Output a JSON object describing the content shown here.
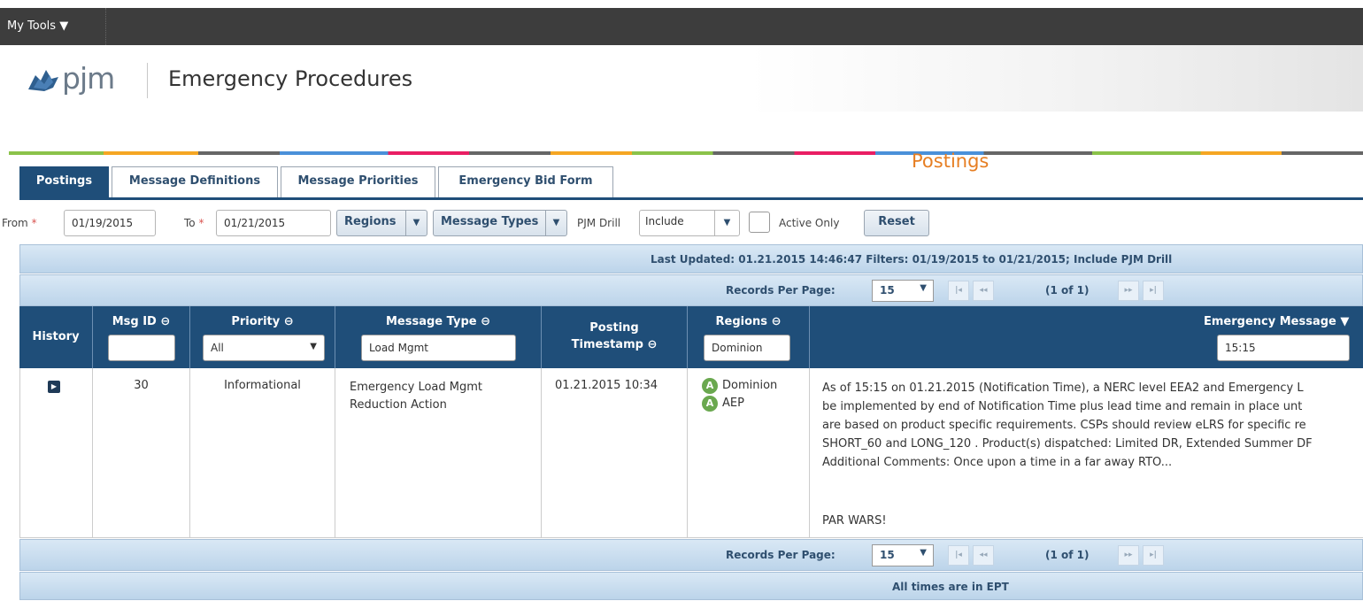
{
  "topbar": {
    "menu_label": "My Tools ▼"
  },
  "brand": {
    "logo_text": "pjm",
    "app_title": "Emergency Procedures"
  },
  "page_heading": "Postings",
  "tabs": [
    {
      "label": "Postings",
      "active": true
    },
    {
      "label": "Message Definitions",
      "active": false
    },
    {
      "label": "Message Priorities",
      "active": false
    },
    {
      "label": "Emergency Bid Form",
      "active": false
    }
  ],
  "filters": {
    "from_label": "From",
    "from_value": "01/19/2015",
    "to_label": "To",
    "to_value": "01/21/2015",
    "required_mark": "*",
    "regions_label": "Regions",
    "message_types_label": "Message Types",
    "pjm_drill_label": "PJM Drill",
    "pjm_drill_value": "Include",
    "active_only_label": "Active Only",
    "reset_label": "Reset"
  },
  "status": {
    "last_updated": "Last Updated: 01.21.2015 14:46:47  Filters: 01/19/2015 to 01/21/2015; Include PJM Drill"
  },
  "pager": {
    "records_per_page_label": "Records Per Page:",
    "records_per_page_value": "15",
    "page_count": "(1 of 1)",
    "first_label": "|◂",
    "prev_label": "◂◂",
    "next_label": "▸▸",
    "last_label": "▸|"
  },
  "grid": {
    "columns": {
      "history": "History",
      "msg_id": "Msg ID ⊖",
      "priority": "Priority ⊖",
      "message_type": "Message Type ⊖",
      "posting_line1": "Posting",
      "posting_line2": "Timestamp ⊖",
      "regions": "Regions ⊖",
      "emergency_message": "Emergency Message ▼"
    },
    "column_filters": {
      "msg_id": "",
      "priority": "All",
      "message_type": "Load Mgmt",
      "regions": "Dominion",
      "emergency_message": "15:15"
    },
    "rows": [
      {
        "msg_id": "30",
        "priority": "Informational",
        "message_type": "Emergency Load Mgmt\nReduction Action",
        "posting_timestamp": "01.21.2015 10:34",
        "regions": [
          {
            "badge": "A",
            "name": "Dominion"
          },
          {
            "badge": "A",
            "name": "AEP"
          }
        ],
        "message": "As of 15:15 on 01.21.2015 (Notification Time), a NERC level EEA2 and Emergency L\nbe implemented by end of Notification Time plus lead time and remain in place unt\nare based on product specific requirements. CSPs should review eLRS for specific re\nSHORT_60 and LONG_120 . Product(s) dispatched: Limited DR, Extended Summer DF\nAdditional Comments: Once upon a time in a far away RTO...",
        "message_footer": "PAR WARS!"
      }
    ]
  },
  "footer": {
    "note": "All times are in EPT"
  },
  "colors": {
    "header_navy": "#1f4e79",
    "heading_orange": "#e67e22",
    "region_badge_green": "#6aa84f",
    "topbar": "#3d3d3d"
  }
}
